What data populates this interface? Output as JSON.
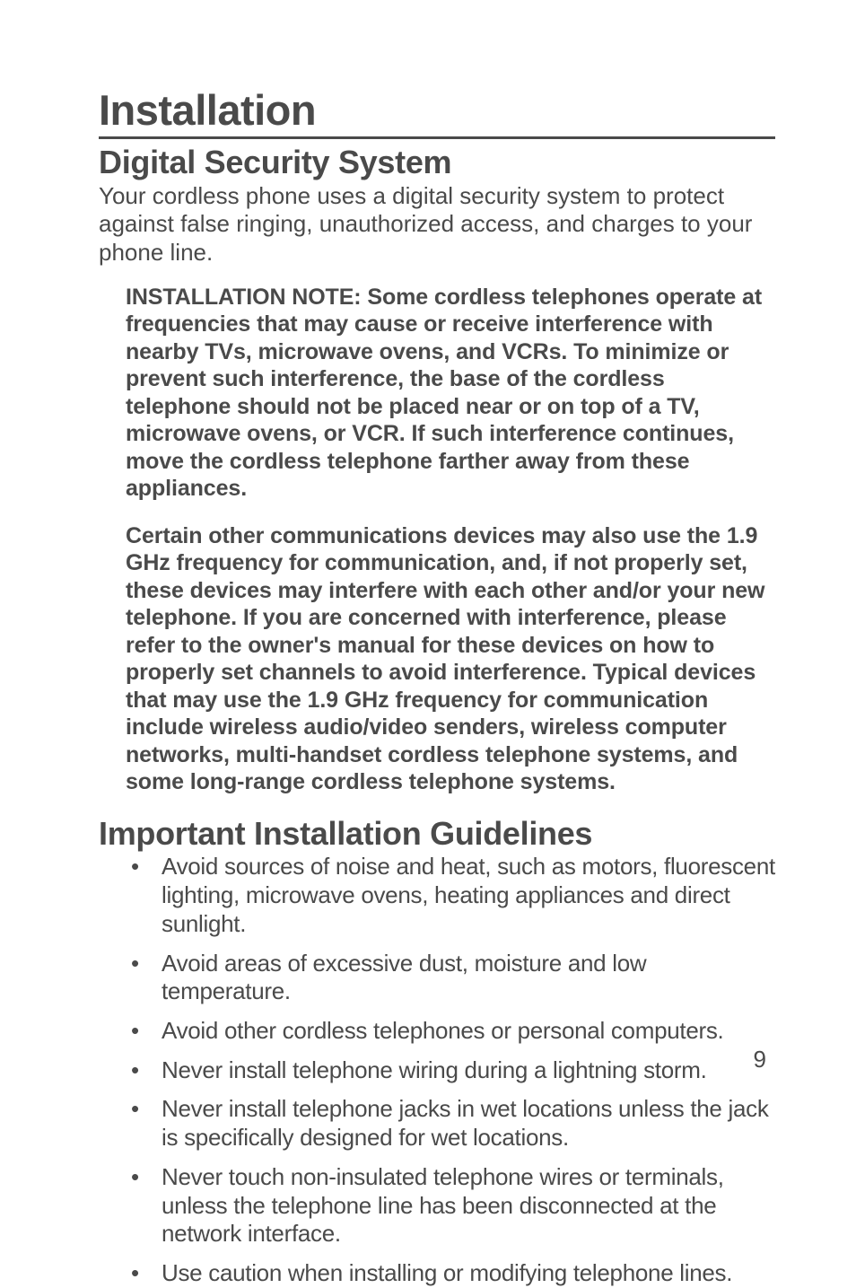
{
  "title": "Installation",
  "section1": {
    "heading": "Digital Security System",
    "intro": "Your cordless phone uses a digital security system to protect against false ringing, unauthorized access, and charges to your phone line.",
    "note1": "INSTALLATION NOTE: Some cordless telephones operate at frequencies that may cause or receive interference with nearby TVs, microwave ovens, and VCRs. To minimize or prevent such interference, the base of the cordless telephone should not be placed near or on top of a TV, microwave ovens, or VCR. If such interference continues, move the cordless telephone farther away from these appliances.",
    "note2": "Certain other communications devices may also use the 1.9 GHz frequency for communication, and, if not properly set, these devices may interfere with each other and/or your new telephone. If you are concerned with interference, please refer to the owner's manual for these devices on how to properly set channels to avoid interference. Typical devices that may use the 1.9 GHz frequency for communication include wireless audio/video senders, wireless computer networks, multi-handset cordless telephone systems, and some long-range cordless telephone systems."
  },
  "section2": {
    "heading": "Important Installation Guidelines",
    "items": [
      "Avoid sources of noise and heat, such as motors, fluorescent lighting, microwave ovens, heating appliances and direct sunlight.",
      "Avoid areas of excessive dust, moisture and low temperature.",
      "Avoid other cordless telephones or personal computers.",
      "Never install telephone wiring during a lightning storm.",
      "Never install telephone jacks in wet locations unless the jack is specifically designed for wet locations.",
      "Never touch non-insulated telephone wires or terminals, unless the telephone line has been disconnected at the network interface.",
      "Use caution when installing or modifying telephone lines."
    ]
  },
  "page_number": "9"
}
